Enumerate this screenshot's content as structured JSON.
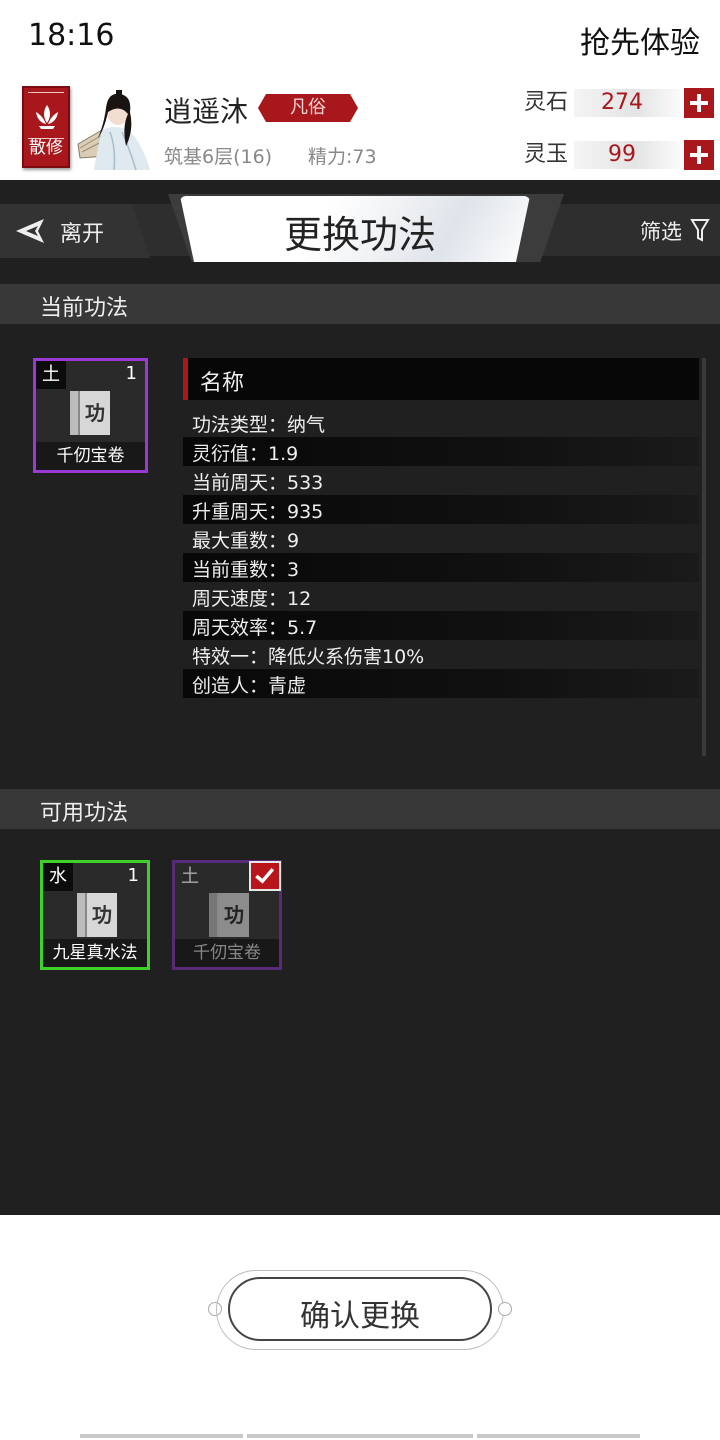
{
  "status_bar": {
    "time": "18:16",
    "right_text": "抢先体验"
  },
  "profile": {
    "sect_badge": "散修",
    "name": "逍遥沐",
    "rank": "凡俗",
    "level": "筑基6层(16)",
    "energy": "精力:73",
    "currencies": [
      {
        "label": "灵石",
        "value": "274"
      },
      {
        "label": "灵玉",
        "value": "99"
      }
    ]
  },
  "nav": {
    "back_label": "离开",
    "title": "更换功法",
    "filter_label": "筛选"
  },
  "current_section": {
    "title": "当前功法",
    "card": {
      "element": "土",
      "count": "1",
      "book_glyph": "功",
      "name": "千仞宝卷"
    },
    "detail_header": "名称",
    "details": [
      "功法类型：纳气",
      "灵衍值：1.9",
      "当前周天：533",
      "升重周天：935",
      "最大重数：9",
      "当前重数：3",
      "周天速度：12",
      "周天效率：5.7",
      "特效一：降低火系伤害10%",
      "创造人：青虚"
    ]
  },
  "available_section": {
    "title": "可用功法",
    "cards": [
      {
        "element": "水",
        "count": "1",
        "book_glyph": "功",
        "name": "九星真水法",
        "selected": false
      },
      {
        "element": "土",
        "count": "",
        "book_glyph": "功",
        "name": "千仞宝卷",
        "selected": true
      }
    ]
  },
  "confirm_label": "确认更换",
  "colors": {
    "accent_red": "#a8171c",
    "purple_rarity": "#9a39d3",
    "green_rarity": "#3fd12a",
    "panel_bg": "#202020"
  }
}
